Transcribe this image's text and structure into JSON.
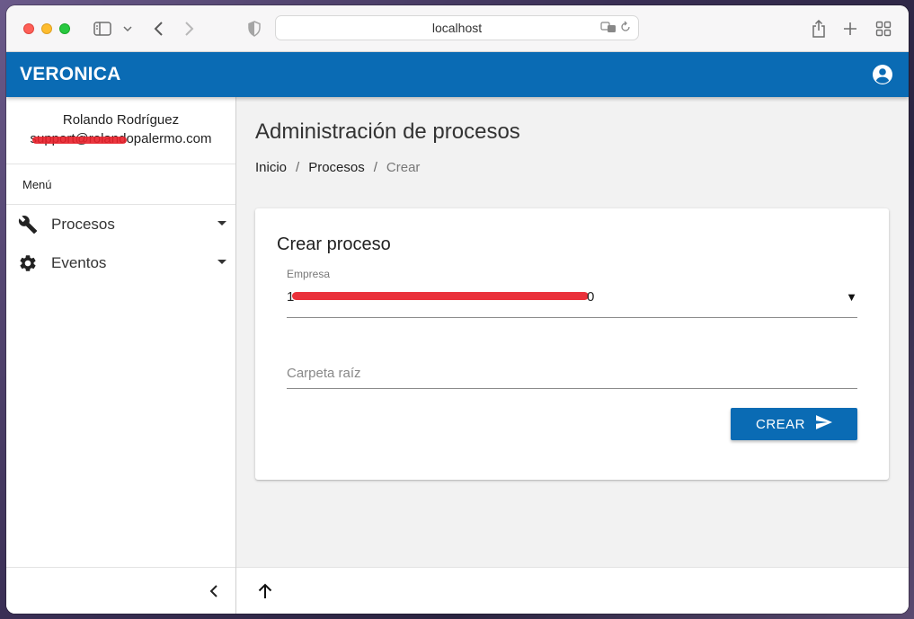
{
  "browser": {
    "url": "localhost"
  },
  "app": {
    "brand": "VERONICA"
  },
  "user": {
    "name": "Rolando Rodríguez",
    "email": "support@rolandopalermo.com"
  },
  "sidebar": {
    "menu_label": "Menú",
    "items": [
      {
        "label": "Procesos",
        "icon": "wrench-icon"
      },
      {
        "label": "Eventos",
        "icon": "gear-icon"
      }
    ]
  },
  "main": {
    "title": "Administración de procesos",
    "breadcrumb": [
      {
        "label": "Inicio"
      },
      {
        "label": "Procesos"
      },
      {
        "label": "Crear"
      }
    ]
  },
  "form": {
    "title": "Crear proceso",
    "empresa_label": "Empresa",
    "empresa_value": "1",
    "empresa_value_suffix": "0",
    "carpeta_placeholder": "Carpeta raíz",
    "submit_label": "CREAR"
  },
  "colors": {
    "primary": "#0a6bb4",
    "redaction": "#e8202a"
  }
}
